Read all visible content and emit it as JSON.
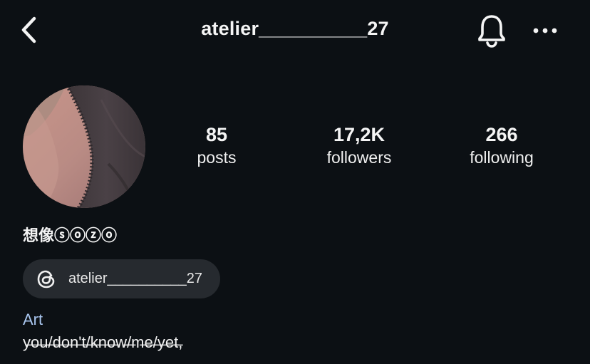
{
  "header": {
    "title": "atelier__________27",
    "back_icon": "chevron-left-icon",
    "notifications_icon": "bell-icon",
    "more_icon": "more-horizontal-icon"
  },
  "profile": {
    "avatar_icon": "profile-photo",
    "stats": [
      {
        "value": "85",
        "label": "posts"
      },
      {
        "value": "17,2K",
        "label": "followers"
      },
      {
        "value": "266",
        "label": "following"
      }
    ],
    "display_name": "想像ⓢⓞⓩⓞ",
    "threads_link": {
      "icon": "threads-icon",
      "label": "atelier__________27"
    },
    "category": "Art",
    "bio": "y̶o̶u̶/̶d̶o̶n̶'̶t̶/̶k̶n̶o̶w̶/̶m̶e̶/̶y̶e̶t̶,"
  },
  "colors": {
    "background": "#0c1014",
    "text": "#f5f5f5",
    "chip_background": "#262a2f",
    "category": "#a8c5ee"
  }
}
